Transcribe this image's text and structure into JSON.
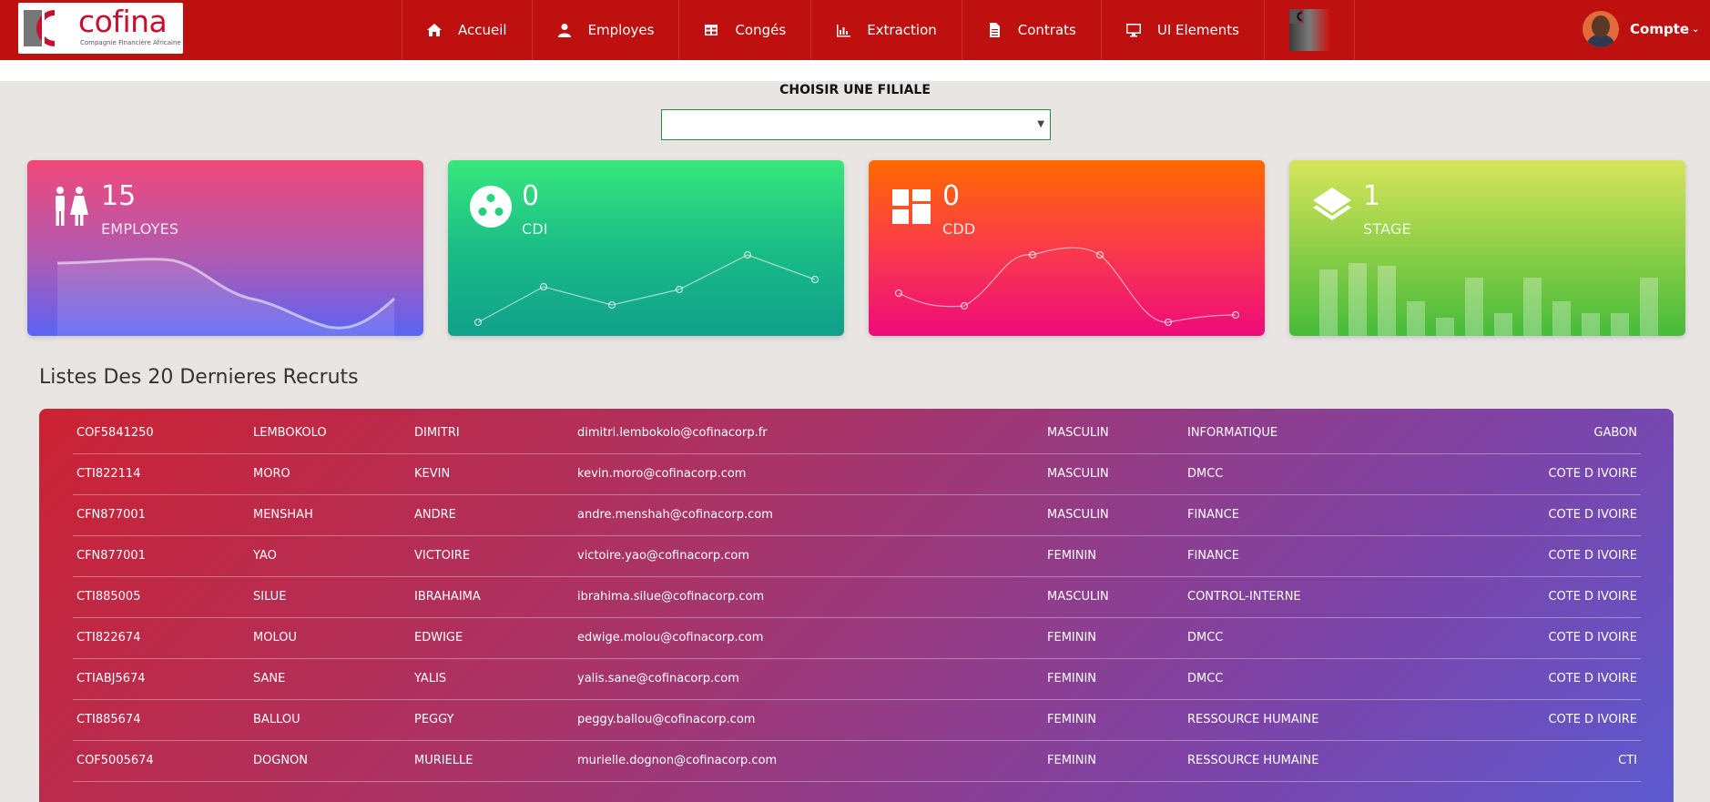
{
  "brand": {
    "name": "cofina",
    "subtitle": "Compagnie Financière Africaine"
  },
  "nav": {
    "items": [
      {
        "label": "Accueil",
        "icon": "home-icon"
      },
      {
        "label": "Employes",
        "icon": "user-icon"
      },
      {
        "label": "Congés",
        "icon": "table-icon"
      },
      {
        "label": "Extraction",
        "icon": "bar-chart-icon"
      },
      {
        "label": "Contrats",
        "icon": "file-icon"
      },
      {
        "label": "UI Elements",
        "icon": "monitor-icon"
      }
    ],
    "account_label": "Compte"
  },
  "filter": {
    "label": "CHOISIR UNE FILIALE",
    "selected": ""
  },
  "cards": [
    {
      "value": "15",
      "label": "EMPLOYES",
      "icon": "people-icon",
      "chart": "area"
    },
    {
      "value": "0",
      "label": "CDI",
      "icon": "circle-dots-icon",
      "chart": "line"
    },
    {
      "value": "0",
      "label": "CDD",
      "icon": "dashboard-icon",
      "chart": "curve"
    },
    {
      "value": "1",
      "label": "STAGE",
      "icon": "layers-icon",
      "chart": "bar"
    }
  ],
  "recruits": {
    "title": "Listes Des 20 Dernieres Recruts",
    "rows": [
      [
        "COF5841250",
        "LEMBOKOLO",
        "DIMITRI",
        "dimitri.lembokolo@cofinacorp.fr",
        "MASCULIN",
        "INFORMATIQUE",
        "GABON"
      ],
      [
        "CTI822114",
        "MORO",
        "KEVIN",
        "kevin.moro@cofinacorp.com",
        "MASCULIN",
        "DMCC",
        "COTE D IVOIRE"
      ],
      [
        "CFN877001",
        "MENSHAH",
        "ANDRE",
        "andre.menshah@cofinacorp.com",
        "MASCULIN",
        "FINANCE",
        "COTE D IVOIRE"
      ],
      [
        "CFN877001",
        "YAO",
        "VICTOIRE",
        "victoire.yao@cofinacorp.com",
        "FEMININ",
        "FINANCE",
        "COTE D IVOIRE"
      ],
      [
        "CTI885005",
        "SILUE",
        "IBRAHAIMA",
        "ibrahima.silue@cofinacorp.com",
        "MASCULIN",
        "CONTROL-INTERNE",
        "COTE D IVOIRE"
      ],
      [
        "CTI822674",
        "MOLOU",
        "EDWIGE",
        "edwige.molou@cofinacorp.com",
        "FEMININ",
        "DMCC",
        "COTE D IVOIRE"
      ],
      [
        "CTIABJ5674",
        "SANE",
        "YALIS",
        "yalis.sane@cofinacorp.com",
        "FEMININ",
        "DMCC",
        "COTE D IVOIRE"
      ],
      [
        "CTI885674",
        "BALLOU",
        "PEGGY",
        "peggy.ballou@cofinacorp.com",
        "FEMININ",
        "RESSOURCE HUMAINE",
        "COTE D IVOIRE"
      ],
      [
        "COF5005674",
        "DOGNON",
        "MURIELLE",
        "murielle.dognon@cofinacorp.com",
        "FEMININ",
        "RESSOURCE HUMAINE",
        "CTI"
      ]
    ]
  },
  "colors": {
    "navbar": "#bf1010",
    "background": "#e8e5e3",
    "accent": "#c8102e"
  }
}
